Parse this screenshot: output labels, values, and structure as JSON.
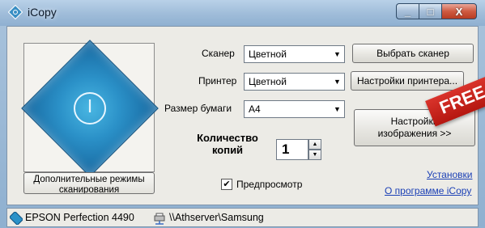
{
  "window": {
    "title": "iCopy",
    "controls": {
      "minimize": "_",
      "maximize": "□",
      "close": "X"
    }
  },
  "left_panel": {
    "scan_button_icon": "power-icon",
    "extra_modes_label": "Дополнительные режимы сканирования"
  },
  "settings": {
    "scanner_label": "Сканер",
    "scanner_value": "Цветной",
    "printer_label": "Принтер",
    "printer_value": "Цветной",
    "paper_label": "Размер бумаги",
    "paper_value": "A4",
    "copies_label": "Количество копий",
    "copies_value": "1",
    "preview_label": "Предпросмотр",
    "preview_checked": true
  },
  "right_buttons": {
    "select_scanner": "Выбрать сканер",
    "printer_settings": "Настройки принтера...",
    "image_settings_line1": "Настройки",
    "image_settings_line2": "изображения >>"
  },
  "links": {
    "setup": "Установки",
    "about": "О программе iCopy"
  },
  "status_bar": {
    "scanner_name": "EPSON Perfection 4490",
    "printer_path": "\\\\Athserver\\Samsung"
  },
  "overlay": {
    "ribbon_text": "FREE",
    "ribbon_color": "#c8211a"
  },
  "colors": {
    "accent_blue": "#2b91c8",
    "link_blue": "#1a3fb5",
    "panel_bg": "#ecebe6"
  }
}
